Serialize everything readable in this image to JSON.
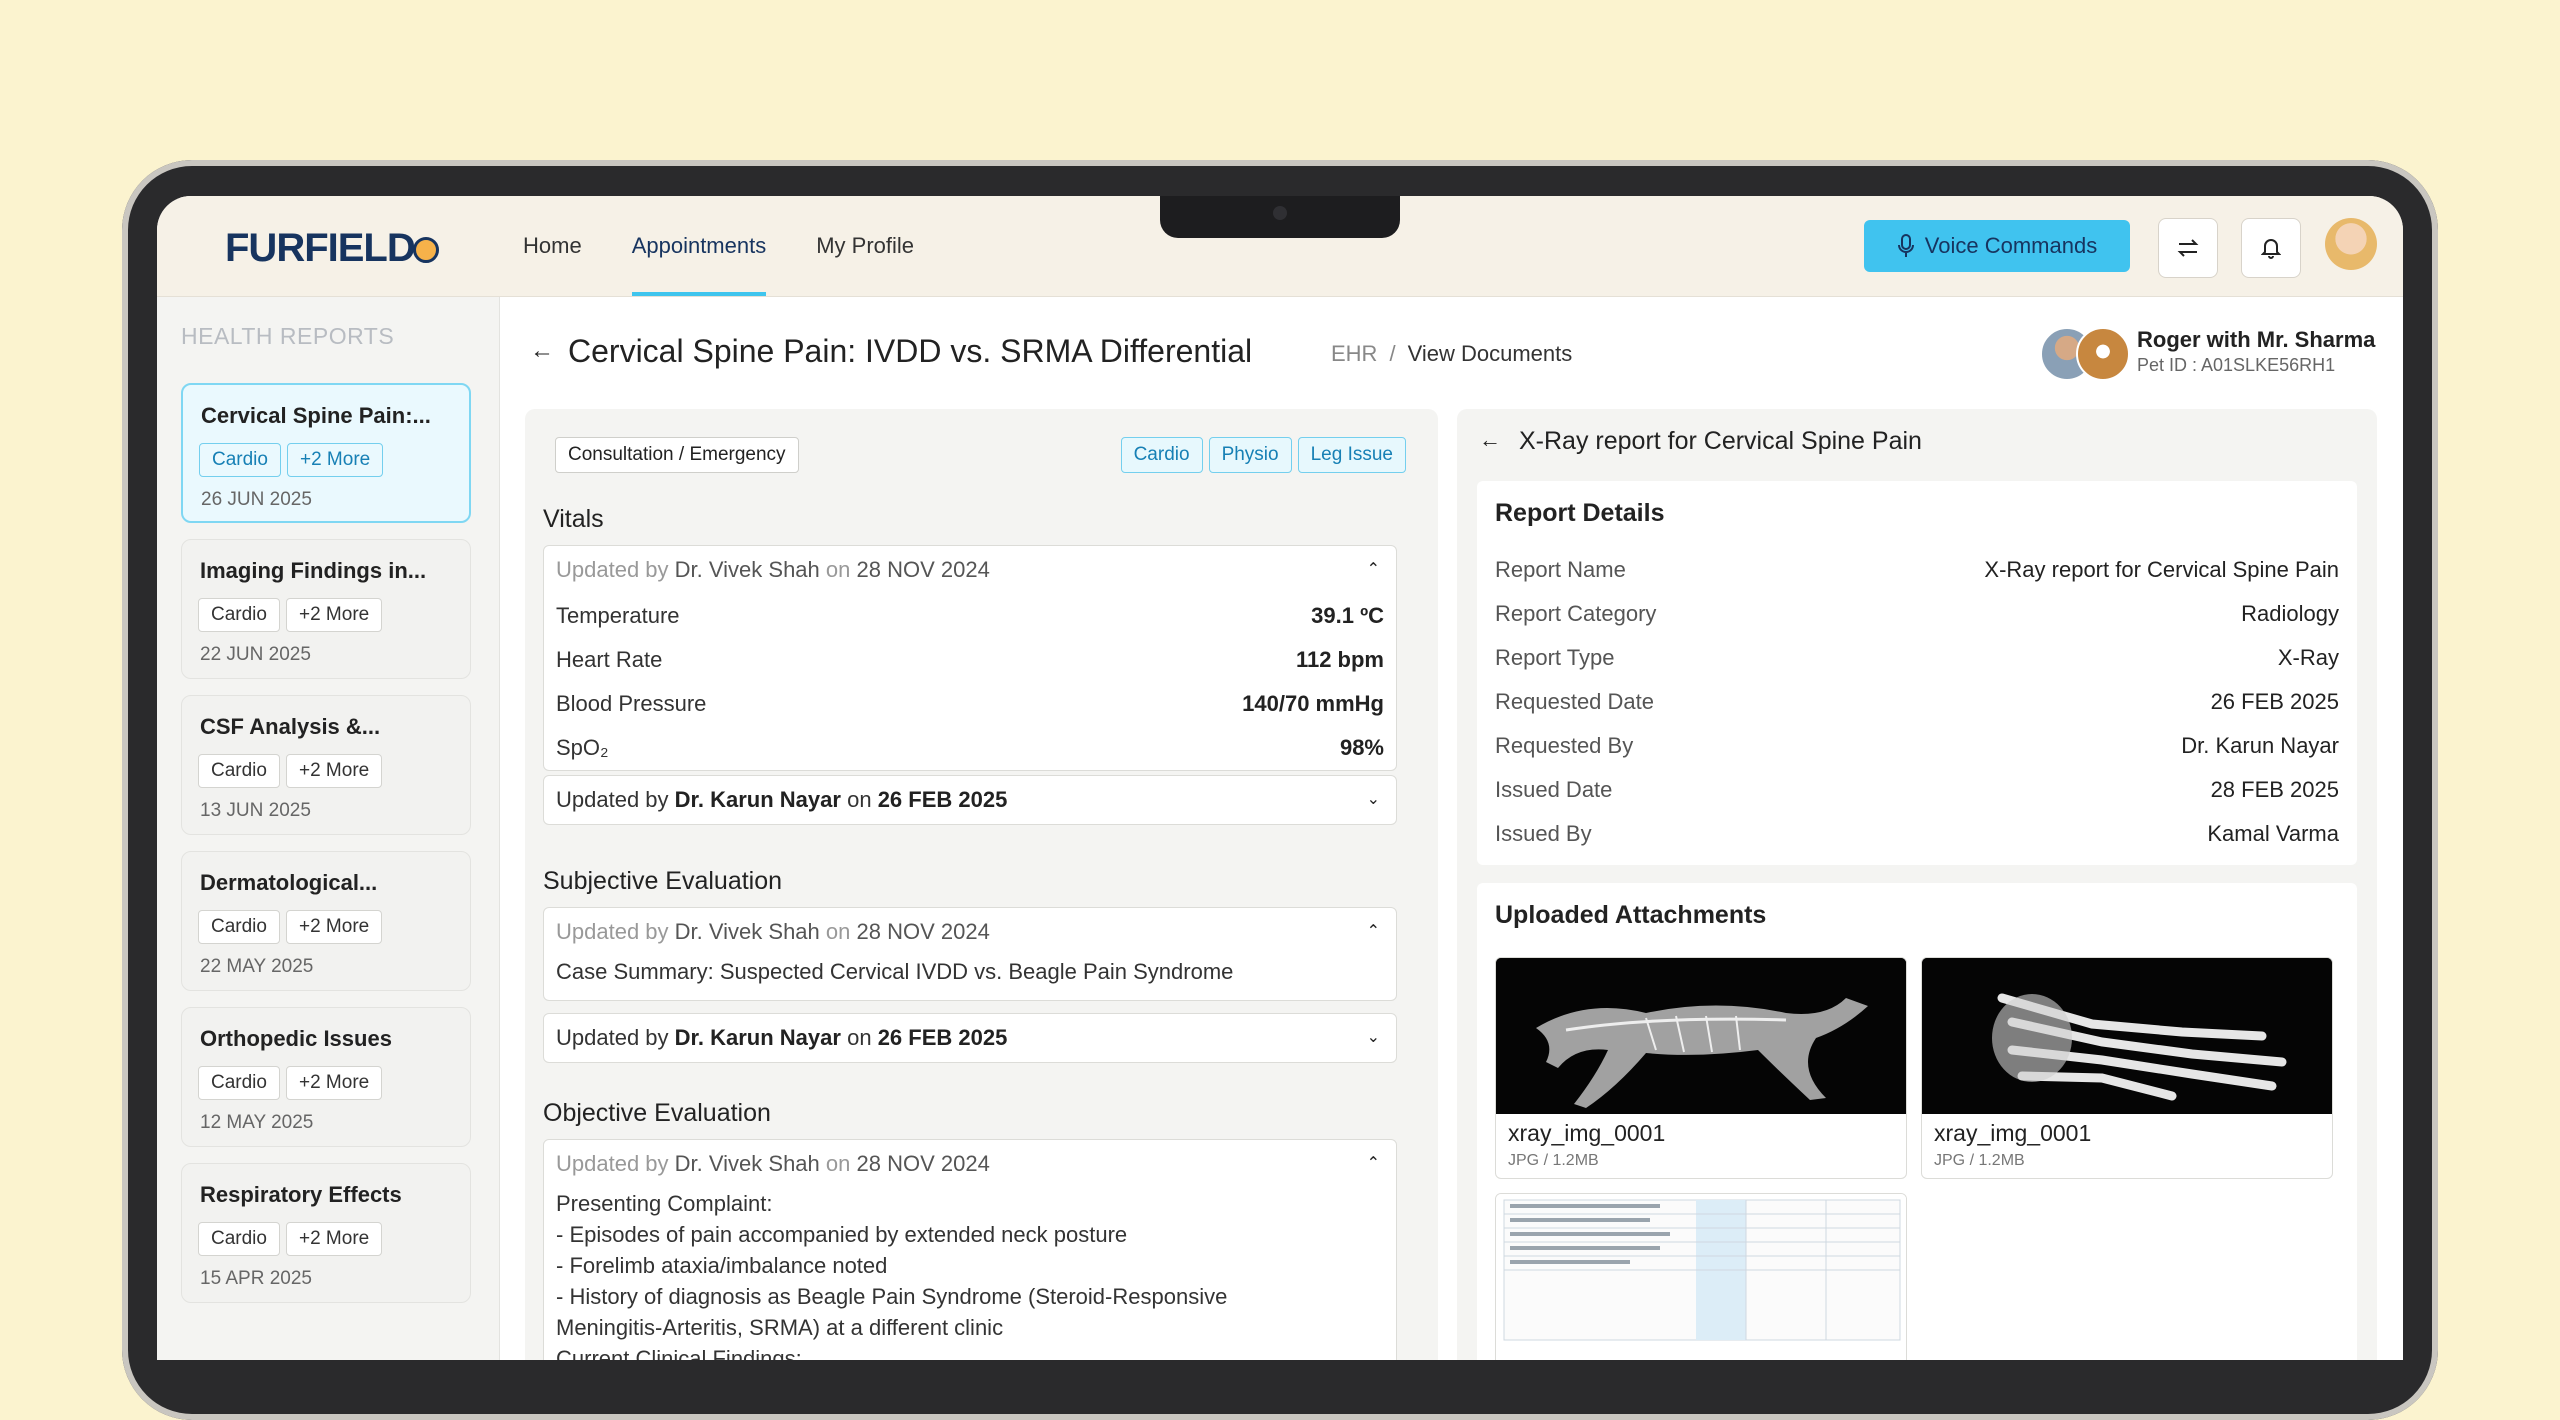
{
  "header": {
    "logo": "FURFIELD",
    "nav": [
      "Home",
      "Appointments",
      "My Profile"
    ],
    "active_nav": "Appointments",
    "voice_button": "Voice Commands",
    "icons": [
      "swap-icon",
      "bell-icon",
      "avatar"
    ]
  },
  "sidebar": {
    "title": "HEALTH REPORTS",
    "reports": [
      {
        "title": "Cervical Spine Pain:...",
        "tag": "Cardio",
        "more": "+2 More",
        "date": "26 JUN 2025"
      },
      {
        "title": "Imaging Findings in...",
        "tag": "Cardio",
        "more": "+2 More",
        "date": "22 JUN 2025"
      },
      {
        "title": "CSF Analysis &...",
        "tag": "Cardio",
        "more": "+2 More",
        "date": "13 JUN 2025"
      },
      {
        "title": "Dermatological...",
        "tag": "Cardio",
        "more": "+2 More",
        "date": "22 MAY 2025"
      },
      {
        "title": "Orthopedic Issues",
        "tag": "Cardio",
        "more": "+2 More",
        "date": "12 MAY 2025"
      },
      {
        "title": "Respiratory Effects",
        "tag": "Cardio",
        "more": "+2 More",
        "date": "15 APR 2025"
      }
    ]
  },
  "page": {
    "title": "Cervical Spine Pain: IVDD vs. SRMA Differential",
    "breadcrumb": [
      "EHR",
      "/",
      "View Documents"
    ],
    "patient": {
      "name": "Roger with Mr. Sharma",
      "pet_id": "Pet ID : A01SLKE56RH1"
    }
  },
  "record": {
    "type": "Consultation / Emergency",
    "tags": [
      "Cardio",
      "Physio",
      "Leg Issue"
    ],
    "vitals": {
      "title": "Vitals",
      "updated_by_prefix": "Updated by",
      "on": "on",
      "open_author": "Dr. Vivek Shah",
      "open_date": "28 NOV 2024",
      "rows": [
        {
          "label": "Temperature",
          "value": "39.1 ºC"
        },
        {
          "label": "Heart Rate",
          "value": "112 bpm"
        },
        {
          "label": "Blood Pressure",
          "value": "140/70 mmHg"
        },
        {
          "label": "SpO₂",
          "value": "98%"
        }
      ],
      "closed_author": "Dr. Karun Nayar",
      "closed_date": "26 FEB 2025"
    },
    "subjective": {
      "title": "Subjective Evaluation",
      "open_author": "Dr. Vivek Shah",
      "open_date": "28 NOV 2024",
      "text": "Case Summary: Suspected Cervical IVDD vs. Beagle Pain Syndrome",
      "closed_author": "Dr. Karun Nayar",
      "closed_date": "26 FEB 2025"
    },
    "objective": {
      "title": "Objective Evaluation",
      "open_author": "Dr. Vivek Shah",
      "open_date": "28 NOV 2024",
      "lines": [
        "Presenting Complaint:",
        "- Episodes of pain accompanied by extended neck posture",
        "- Forelimb ataxia/imbalance noted",
        "- History of diagnosis as Beagle Pain Syndrome (Steroid-Responsive",
        "Meningitis-Arteritis, SRMA) at a different clinic",
        "Current Clinical Findings:"
      ]
    }
  },
  "report": {
    "title": "X-Ray report for Cervical Spine Pain",
    "details_heading": "Report Details",
    "details": [
      {
        "k": "Report Name",
        "v": "X-Ray report for Cervical Spine Pain"
      },
      {
        "k": "Report Category",
        "v": "Radiology"
      },
      {
        "k": "Report Type",
        "v": "X-Ray"
      },
      {
        "k": "Requested Date",
        "v": "26 FEB 2025"
      },
      {
        "k": "Requested By",
        "v": "Dr. Karun Nayar"
      },
      {
        "k": "Issued Date",
        "v": "28 FEB 2025"
      },
      {
        "k": "Issued By",
        "v": "Kamal Varma"
      }
    ],
    "attachments_heading": "Uploaded Attachments",
    "attachments": [
      {
        "name": "xray_img_0001",
        "meta": "JPG / 1.2MB"
      },
      {
        "name": "xray_img_0001",
        "meta": "JPG / 1.2MB"
      }
    ]
  }
}
